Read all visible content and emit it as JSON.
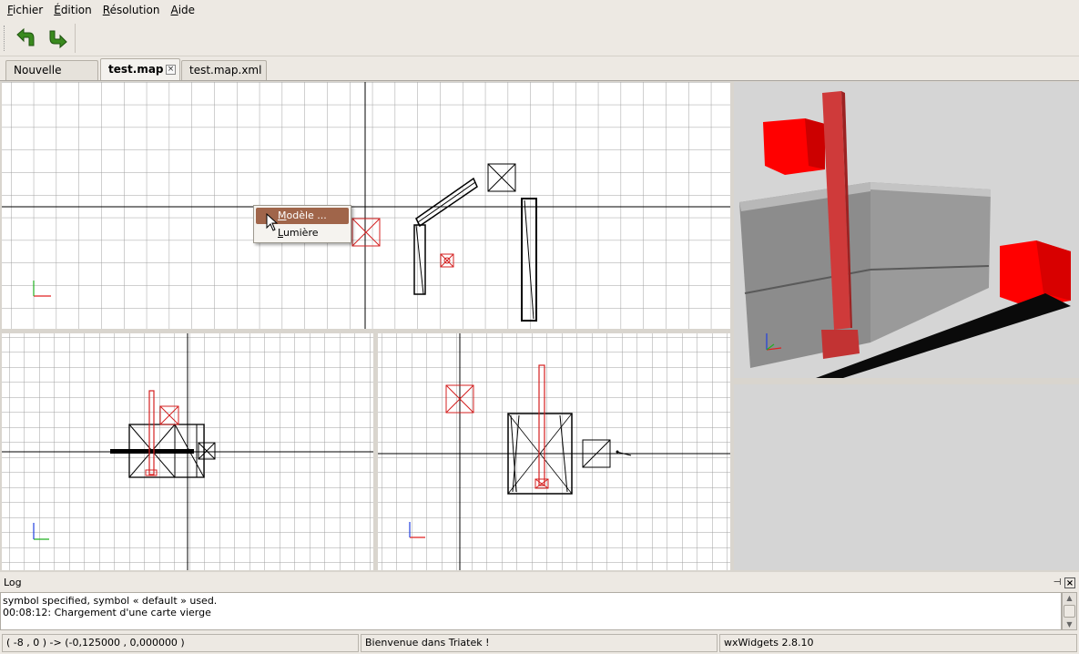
{
  "menubar": {
    "items": [
      {
        "first": "F",
        "rest": "ichier"
      },
      {
        "first": "É",
        "rest": "dition"
      },
      {
        "first": "R",
        "rest": "ésolution"
      },
      {
        "first": "A",
        "rest": "ide"
      }
    ]
  },
  "toolbar": {
    "undo_icon": "undo-arrow-icon",
    "redo_icon": "redo-arrow-icon"
  },
  "tabs": [
    {
      "label": "Nouvelle carte"
    },
    {
      "label": "test.map",
      "active": true,
      "close": "×"
    },
    {
      "label": "test.map.xml"
    }
  ],
  "context_menu": {
    "items": [
      {
        "first": "M",
        "rest": "odèle ..."
      },
      {
        "first": "L",
        "rest": "umière"
      }
    ]
  },
  "log": {
    "title": "Log",
    "pin": "⊣",
    "close": "×",
    "lines": [
      "symbol specified, symbol « default » used.",
      "00:08:12: Chargement d'une carte vierge"
    ]
  },
  "status": {
    "coords": "( -8 , 0 ) -> (-0,125000 , 0,000000 )",
    "message": "Bienvenue dans Triatek !",
    "version": "wxWidgets 2.8.10"
  },
  "colors": {
    "selection": "#a0654a",
    "red_object": "#d42020",
    "grid": "#a0a0a0"
  }
}
